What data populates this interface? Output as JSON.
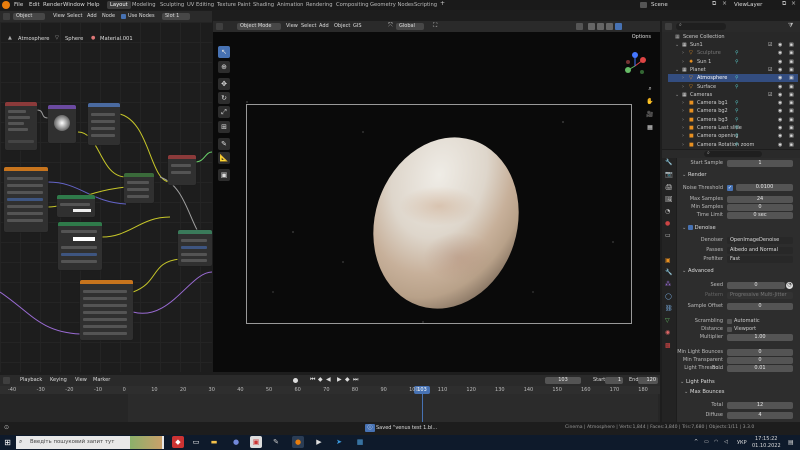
{
  "app": {
    "title": "Blender [D:\\Blender Projects\\venus test 1.blend]"
  },
  "menubar": [
    "File",
    "Edit",
    "Render",
    "Window",
    "Help"
  ],
  "workspaces": [
    "Layout",
    "Modeling",
    "Sculpting",
    "UV Editing",
    "Texture Paint",
    "Shading",
    "Animation",
    "Rendering",
    "Compositing",
    "Geometry Nodes",
    "Scripting"
  ],
  "scene": {
    "name": "Scene",
    "view_layer": "ViewLayer"
  },
  "node_editor": {
    "object_mode": "Object",
    "menu": [
      "View",
      "Select",
      "Add",
      "Node"
    ],
    "use_nodes": "Use Nodes",
    "slot": "Slot 1",
    "breadcrumb": [
      "Atmosphere",
      "Sphere",
      "Material.001"
    ]
  },
  "viewport": {
    "mode": "Object Mode",
    "menu": [
      "View",
      "Select",
      "Add",
      "Object",
      "GIS"
    ],
    "orientation": "Global",
    "options": "Options"
  },
  "outliner": {
    "title": "Scene Collection",
    "rows": [
      {
        "label": "Sun1",
        "level": 1,
        "kind": "collection"
      },
      {
        "label": "Sculpture",
        "level": 2,
        "kind": "object",
        "dim": true
      },
      {
        "label": "Sun 1",
        "level": 2,
        "kind": "light"
      },
      {
        "label": "Planet",
        "level": 1,
        "kind": "collection"
      },
      {
        "label": "Atmosphere",
        "level": 2,
        "kind": "object",
        "selected": true
      },
      {
        "label": "Surface",
        "level": 2,
        "kind": "object"
      },
      {
        "label": "Cameras",
        "level": 1,
        "kind": "collection"
      },
      {
        "label": "Camera bg1",
        "level": 2,
        "kind": "camera"
      },
      {
        "label": "Camera bg2",
        "level": 2,
        "kind": "camera"
      },
      {
        "label": "Camera bg3",
        "level": 2,
        "kind": "camera"
      },
      {
        "label": "Camera Last slide",
        "level": 2,
        "kind": "camera"
      },
      {
        "label": "Camera opening",
        "level": 2,
        "kind": "camera"
      },
      {
        "label": "Camera Rotation zoom",
        "level": 2,
        "kind": "camera"
      }
    ]
  },
  "properties": {
    "start_sample": {
      "label": "Start Sample",
      "value": "1"
    },
    "render_section": "Render",
    "noise_threshold": {
      "label": "Noise Threshold",
      "value": "0.0100"
    },
    "max_samples": {
      "label": "Max Samples",
      "value": "24"
    },
    "min_samples": {
      "label": "Min Samples",
      "value": "0"
    },
    "time_limit": {
      "label": "Time Limit",
      "value": "0 sec"
    },
    "denoise_section": "Denoise",
    "denoiser": {
      "label": "Denoiser",
      "value": "OpenImageDenoise"
    },
    "passes": {
      "label": "Passes",
      "value": "Albedo and Normal"
    },
    "prefilter": {
      "label": "Prefilter",
      "value": "Fast"
    },
    "advanced_section": "Advanced",
    "seed": {
      "label": "Seed",
      "value": "0"
    },
    "pattern": {
      "label": "Pattern",
      "value": "Progressive Multi-Jitter"
    },
    "sample_offset": {
      "label": "Sample Offset",
      "value": "0"
    },
    "scrambling_distance": {
      "label": "Scrambling Distance",
      "automatic": "Automatic",
      "viewport": "Viewport"
    },
    "multiplier": {
      "label": "Multiplier",
      "value": "1.00"
    },
    "min_light_bounces": {
      "label": "Min Light Bounces",
      "value": "0"
    },
    "min_transparent_bounces": {
      "label": "Min Transparent Bo...",
      "value": "0"
    },
    "light_threshold": {
      "label": "Light Threshold",
      "value": "0.01"
    },
    "light_paths_section": "Light Paths",
    "max_bounces_section": "Max Bounces",
    "total": {
      "label": "Total",
      "value": "12"
    },
    "diffuse": {
      "label": "Diffuse",
      "value": "4"
    }
  },
  "timeline": {
    "menu": [
      "Playback",
      "Keying",
      "View",
      "Marker"
    ],
    "current_frame": "103",
    "start_label": "Start",
    "start": "1",
    "end_label": "End",
    "end": "120",
    "ticks": [
      "-40",
      "-30",
      "-20",
      "-10",
      "0",
      "10",
      "20",
      "30",
      "40",
      "50",
      "60",
      "70",
      "80",
      "90",
      "100",
      "110",
      "120",
      "130",
      "140",
      "150",
      "160",
      "170",
      "180"
    ]
  },
  "statusbar": {
    "message": "Saved \"venus test 1.bl...",
    "stats": "Cinema | Atmosphere | Verts:1,844 | Faces:3,840 | Tris:7,680 | Objects:1/11 | 3.3.0"
  },
  "taskbar": {
    "search_placeholder": "Введіть пошуковий запит тут",
    "lang": "УКР",
    "time": "17:15:22",
    "date": "01.10.2022"
  },
  "colors": {
    "accent": "#4772b3",
    "selected_row": "#334d80",
    "header": "#2a2a2a"
  }
}
